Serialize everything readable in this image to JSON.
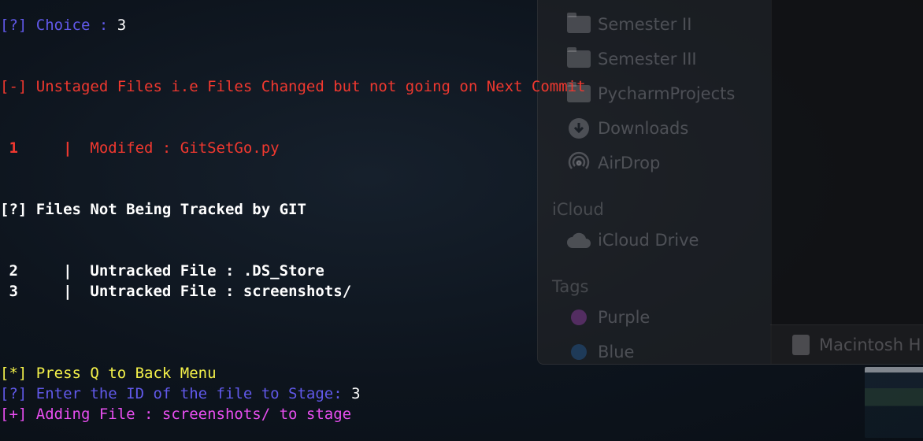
{
  "terminal": {
    "choice_prompt": "[?] Choice : ",
    "choice_value": "3",
    "unstaged_header": "[-] Unstaged Files i.e Files Changed but not going on Next Commit",
    "unstaged_files": [
      {
        "id": " 1",
        "sep": "     |  ",
        "text": "Modifed : GitSetGo.py"
      }
    ],
    "untracked_header": "[?] Files Not Being Tracked by GIT",
    "untracked_files": [
      {
        "id": " 2",
        "sep": "     |  ",
        "text": "Untracked File : .DS_Store"
      },
      {
        "id": " 3",
        "sep": "     |  ",
        "text": "Untracked File : screenshots/"
      }
    ],
    "back_hint": "[*] Press Q to Back Menu",
    "stage_prompt": "[?] Enter the ID of the file to Stage: ",
    "stage_value": "3",
    "adding_msg": "[+] Adding File : screenshots/ to stage"
  },
  "finder": {
    "favorites": [
      {
        "label": "Semester II",
        "icon": "folder-icon"
      },
      {
        "label": "Semester III",
        "icon": "folder-icon"
      },
      {
        "label": "PycharmProjects",
        "icon": "folder-icon"
      },
      {
        "label": "Downloads",
        "icon": "download-circle-icon"
      },
      {
        "label": "AirDrop",
        "icon": "airdrop-icon"
      }
    ],
    "icloud_header": "iCloud",
    "icloud_items": [
      {
        "label": "iCloud Drive",
        "icon": "cloud-icon"
      }
    ],
    "tags_header": "Tags",
    "tags": [
      {
        "label": "Purple",
        "color": "#7a3f8a"
      },
      {
        "label": "Blue",
        "color": "#2f5b8a"
      }
    ],
    "disk_label": "Macintosh H"
  },
  "colors": {
    "blue": "#6159ea",
    "red": "#f0382f",
    "white": "#ffffff",
    "yellow": "#f5f24a",
    "magenta": "#e84ef0"
  }
}
